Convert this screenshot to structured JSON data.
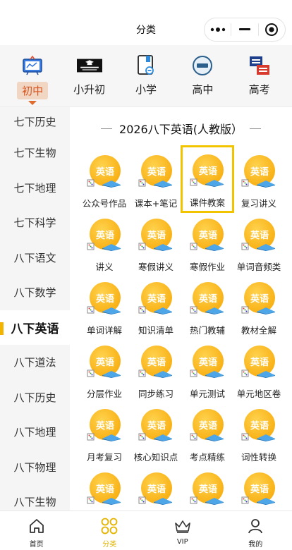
{
  "header": {
    "title": "分类"
  },
  "capsule": {
    "more_icon": "more-dots-icon",
    "minimize_icon": "minimize-icon",
    "close_icon": "target-close-icon"
  },
  "categories": [
    {
      "label": "初中",
      "icon": "board-icon",
      "active": true
    },
    {
      "label": "小升初",
      "icon": "graduation-banner-icon",
      "active": false
    },
    {
      "label": "小学",
      "icon": "book-link-icon",
      "active": false
    },
    {
      "label": "高中",
      "icon": "gaozhong-badge-icon",
      "active": false
    },
    {
      "label": "高考",
      "icon": "gaokao-icon",
      "active": false
    }
  ],
  "sidebar": {
    "items": [
      {
        "label": "七下历史"
      },
      {
        "label": "七下生物"
      },
      {
        "label": "七下地理"
      },
      {
        "label": "七下科学"
      },
      {
        "label": "八下语文"
      },
      {
        "label": "八下数学"
      },
      {
        "label": "八下英语",
        "active": true
      },
      {
        "label": "八下道法"
      },
      {
        "label": "八下历史"
      },
      {
        "label": "八下地理"
      },
      {
        "label": "八下物理"
      },
      {
        "label": "八下生物"
      }
    ]
  },
  "main": {
    "section_title": "2026八下英语(人教版）",
    "badge_text": "英语",
    "items": [
      {
        "label": "公众号作品"
      },
      {
        "label": "课本+笔记"
      },
      {
        "label": "课件教案",
        "highlight": true
      },
      {
        "label": "复习讲义"
      },
      {
        "label": "讲义"
      },
      {
        "label": "寒假讲义"
      },
      {
        "label": "寒假作业"
      },
      {
        "label": "单词音频类"
      },
      {
        "label": "单词详解"
      },
      {
        "label": "知识清单"
      },
      {
        "label": "热门教辅"
      },
      {
        "label": "教材全解"
      },
      {
        "label": "分层作业"
      },
      {
        "label": "同步练习"
      },
      {
        "label": "单元测试"
      },
      {
        "label": "单元地区卷"
      },
      {
        "label": "月考复习"
      },
      {
        "label": "核心知识点"
      },
      {
        "label": "考点精练"
      },
      {
        "label": "词性转换"
      },
      {
        "label": ""
      },
      {
        "label": ""
      },
      {
        "label": ""
      },
      {
        "label": ""
      }
    ]
  },
  "tabbar": {
    "items": [
      {
        "label": "首页",
        "icon": "home-icon"
      },
      {
        "label": "分类",
        "icon": "category-icon",
        "active": true
      },
      {
        "label": "VIP",
        "icon": "crown-icon"
      },
      {
        "label": "我的",
        "icon": "profile-icon"
      }
    ]
  },
  "colors": {
    "accent": "#f2b400",
    "active_orange": "#e06a2c",
    "badge": "#f6a400"
  }
}
